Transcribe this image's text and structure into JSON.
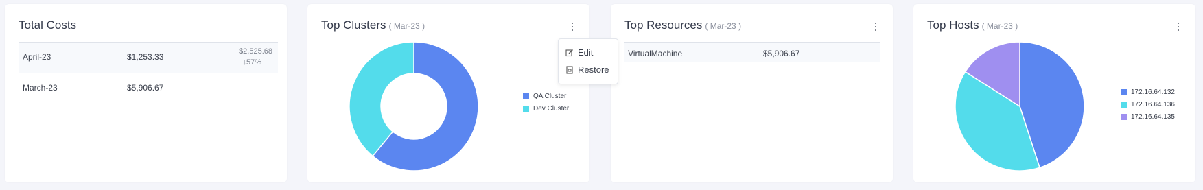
{
  "total_costs": {
    "title": "Total Costs",
    "rows": [
      {
        "label": "April-23",
        "amount": "$1,253.33",
        "previous": "$2,525.68",
        "change": "↓57%"
      },
      {
        "label": "March-23",
        "amount": "$5,906.67"
      }
    ]
  },
  "top_clusters": {
    "title": "Top Clusters",
    "period": "( Mar-23 )",
    "menu": {
      "edit_label": "Edit",
      "restore_label": "Restore"
    }
  },
  "top_resources": {
    "title": "Top Resources",
    "period": "( Mar-23 )",
    "rows": [
      {
        "label": "VirtualMachine",
        "amount": "$5,906.67"
      }
    ]
  },
  "top_hosts": {
    "title": "Top Hosts",
    "period": "( Mar-23 )"
  },
  "chart_data": [
    {
      "type": "pie",
      "variant": "donut",
      "categories": [
        "QA Cluster",
        "Dev Cluster"
      ],
      "values": [
        61,
        39
      ],
      "colors": [
        "#5b86f0",
        "#53dceb"
      ],
      "legend": "right"
    },
    {
      "type": "pie",
      "categories": [
        "172.16.64.132",
        "172.16.64.136",
        "172.16.64.135"
      ],
      "values": [
        45,
        39,
        16
      ],
      "colors": [
        "#5b86f0",
        "#53dceb",
        "#9f8ff0"
      ],
      "legend": "right"
    }
  ]
}
